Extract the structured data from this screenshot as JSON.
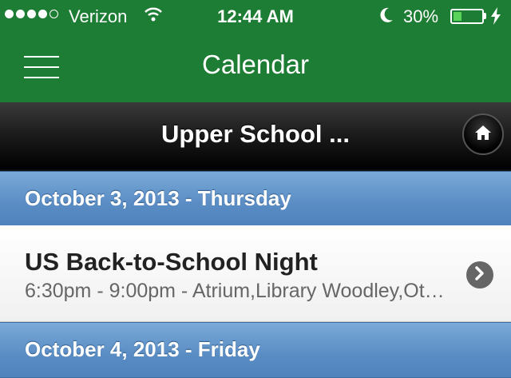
{
  "status_bar": {
    "carrier": "Verizon",
    "time": "12:44 AM",
    "battery_percent": "30%",
    "battery_level": 0.3,
    "signal_bars": 4,
    "signal_total": 5
  },
  "nav": {
    "title": "Calendar",
    "menu_icon": "hamburger-menu-icon"
  },
  "sub_header": {
    "title": "Upper School ...",
    "home_icon": "home-icon"
  },
  "days": [
    {
      "date_label": "October 3, 2013 - Thursday",
      "events": [
        {
          "title": "US Back-to-School Night",
          "detail": "6:30pm - 9:00pm - Atrium,Library Woodley,Ot…"
        }
      ]
    },
    {
      "date_label": "October 4, 2013 - Friday",
      "events": []
    }
  ],
  "colors": {
    "nav_green": "#1e7d34",
    "date_header_blue": "#5a8cc4",
    "battery_green": "#5ad35a"
  }
}
